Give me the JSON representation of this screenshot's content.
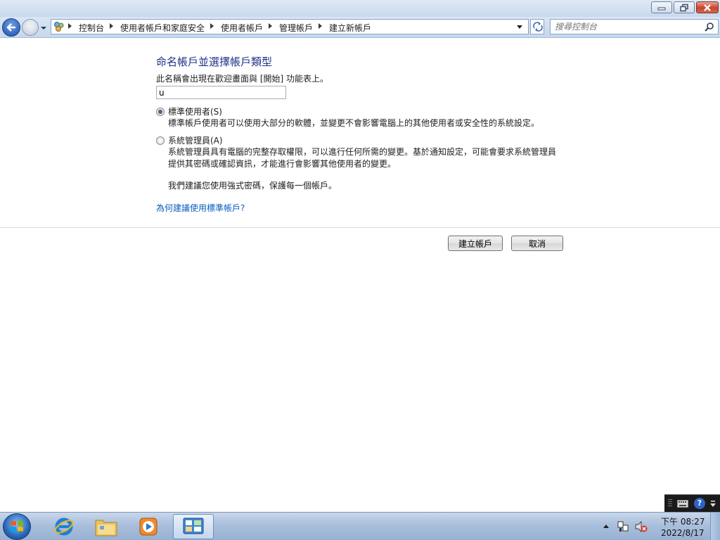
{
  "window": {
    "buttons": {
      "minimize": "minimize-icon",
      "maximize": "restore-icon",
      "close": "close-icon"
    }
  },
  "address_bar": {
    "breadcrumbs": [
      "控制台",
      "使用者帳戶和家庭安全",
      "使用者帳戶",
      "管理帳戶",
      "建立新帳戶"
    ],
    "search_placeholder": "搜尋控制台"
  },
  "page": {
    "heading": "命名帳戶並選擇帳戶類型",
    "description": "此名稱會出現在歡迎畫面與 [開始] 功能表上。",
    "name_value": "u",
    "options": {
      "standard": {
        "label": "標準使用者(S)",
        "text": "標準帳戶使用者可以使用大部分的軟體，並變更不會影響電腦上的其他使用者或安全性的系統設定。",
        "selected": true
      },
      "admin": {
        "label": "系統管理員(A)",
        "text_line1": "系統管理員具有電腦的完整存取權限，可以進行任何所需的變更。基於通知設定，可能會要求系統管理員",
        "text_line2": "提供其密碼或確認資訊，才能進行會影響其他使用者的變更。",
        "selected": false
      }
    },
    "password_note": "我們建議您使用強式密碼，保護每一個帳戶。",
    "why_link": "為何建議使用標準帳戶?",
    "create_button": "建立帳戶",
    "cancel_button": "取消"
  },
  "language_bar": {
    "icons": [
      "keyboard-icon",
      "help-icon"
    ],
    "help_glyph": "?"
  },
  "taskbar": {
    "items": [
      "internet-explorer-icon",
      "windows-explorer-icon",
      "media-player-icon",
      "control-panel-icon"
    ],
    "clock_time": "下午 08:27",
    "clock_date": "2022/8/17"
  },
  "colors": {
    "heading": "#1e3287",
    "link": "#0b5ebf",
    "taskbar": "#a9bfdc"
  }
}
